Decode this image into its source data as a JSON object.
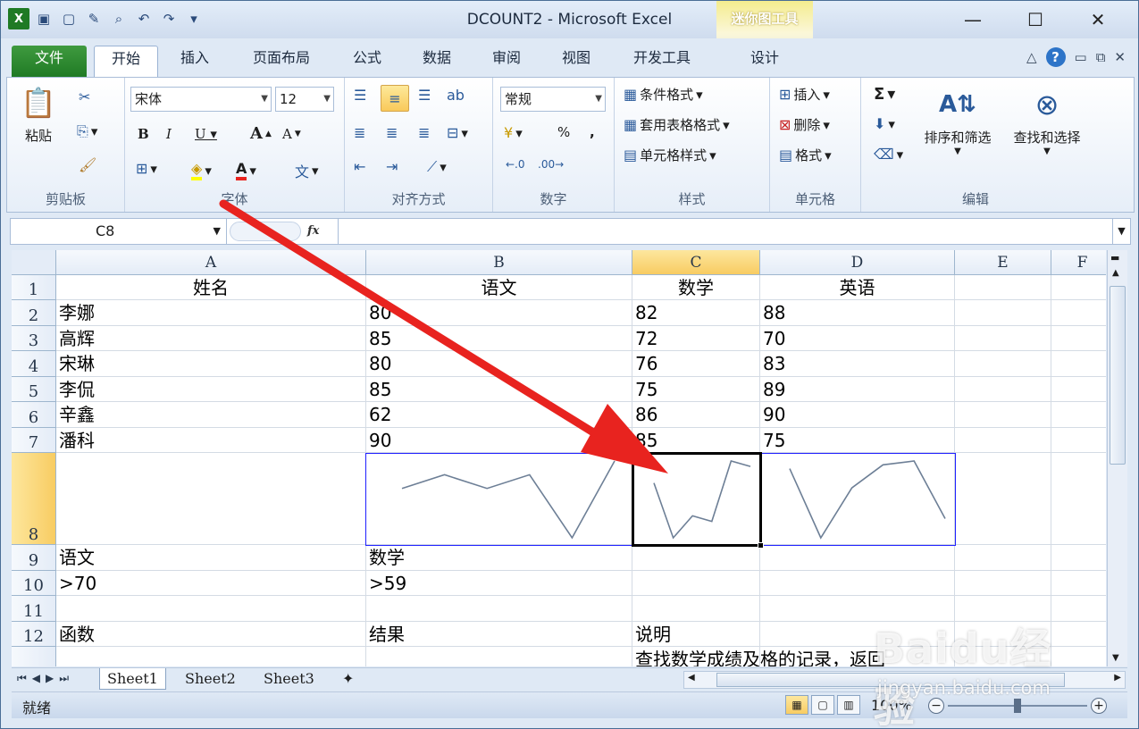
{
  "window": {
    "title": "DCOUNT2  -  Microsoft Excel",
    "context_tab_label": "迷你图工具"
  },
  "ribbon_tabs": [
    "文件",
    "开始",
    "插入",
    "页面布局",
    "公式",
    "数据",
    "审阅",
    "视图",
    "开发工具",
    "设计"
  ],
  "clipboard": {
    "paste": "粘贴",
    "label": "剪贴板"
  },
  "font": {
    "name": "宋体",
    "size": "12",
    "label": "字体"
  },
  "alignment": {
    "label": "对齐方式"
  },
  "number": {
    "format": "常规",
    "label": "数字",
    "percent": "%",
    "comma": ","
  },
  "styles": {
    "conditional": "条件格式",
    "table": "套用表格格式",
    "cell": "单元格样式",
    "label": "样式"
  },
  "cells": {
    "insert": "插入",
    "delete": "删除",
    "format": "格式",
    "label": "单元格"
  },
  "editing": {
    "sort": "排序和筛选",
    "find": "查找和选择",
    "label": "编辑",
    "sum": "Σ"
  },
  "formula_bar": {
    "name_box": "C8",
    "fx": "fx",
    "value": ""
  },
  "columns": [
    "A",
    "B",
    "C",
    "D",
    "E",
    "F"
  ],
  "rows": [
    {
      "n": "1",
      "a": "姓名",
      "b": "语文",
      "c": "数学",
      "d": "英语"
    },
    {
      "n": "2",
      "a": "李娜",
      "b": "80",
      "c": "82",
      "d": "88"
    },
    {
      "n": "3",
      "a": "高辉",
      "b": "85",
      "c": "72",
      "d": "70"
    },
    {
      "n": "4",
      "a": "宋琳",
      "b": "80",
      "c": "76",
      "d": "83"
    },
    {
      "n": "5",
      "a": "李侃",
      "b": "85",
      "c": "75",
      "d": "89"
    },
    {
      "n": "6",
      "a": "辛鑫",
      "b": "62",
      "c": "86",
      "d": "90"
    },
    {
      "n": "7",
      "a": "潘科",
      "b": "90",
      "c": "85",
      "d": "75"
    },
    {
      "n": "8",
      "a": "",
      "b": "",
      "c": "",
      "d": ""
    },
    {
      "n": "9",
      "a": "语文",
      "b": "数学",
      "c": "",
      "d": ""
    },
    {
      "n": "10",
      "a": ">70",
      "b": ">59",
      "c": "",
      "d": ""
    },
    {
      "n": "11",
      "a": "",
      "b": "",
      "c": "",
      "d": ""
    },
    {
      "n": "12",
      "a": "函数",
      "b": "结果",
      "c": "说明",
      "d": ""
    },
    {
      "n": "",
      "a": "",
      "b": "",
      "c": "查找数学成绩及格的记录，返回",
      "d": ""
    }
  ],
  "sheets": [
    "Sheet1",
    "Sheet2",
    "Sheet3"
  ],
  "status": {
    "ready": "就绪",
    "zoom": "100%"
  },
  "watermark": {
    "logo": "Baidu经验",
    "url": "jingyan.baidu.com"
  },
  "colors": {
    "arrow": "#e8231f",
    "sparkline": "#6d7f96",
    "sparkline_box": "#2020ff",
    "selected_header": "#f8cc62"
  }
}
